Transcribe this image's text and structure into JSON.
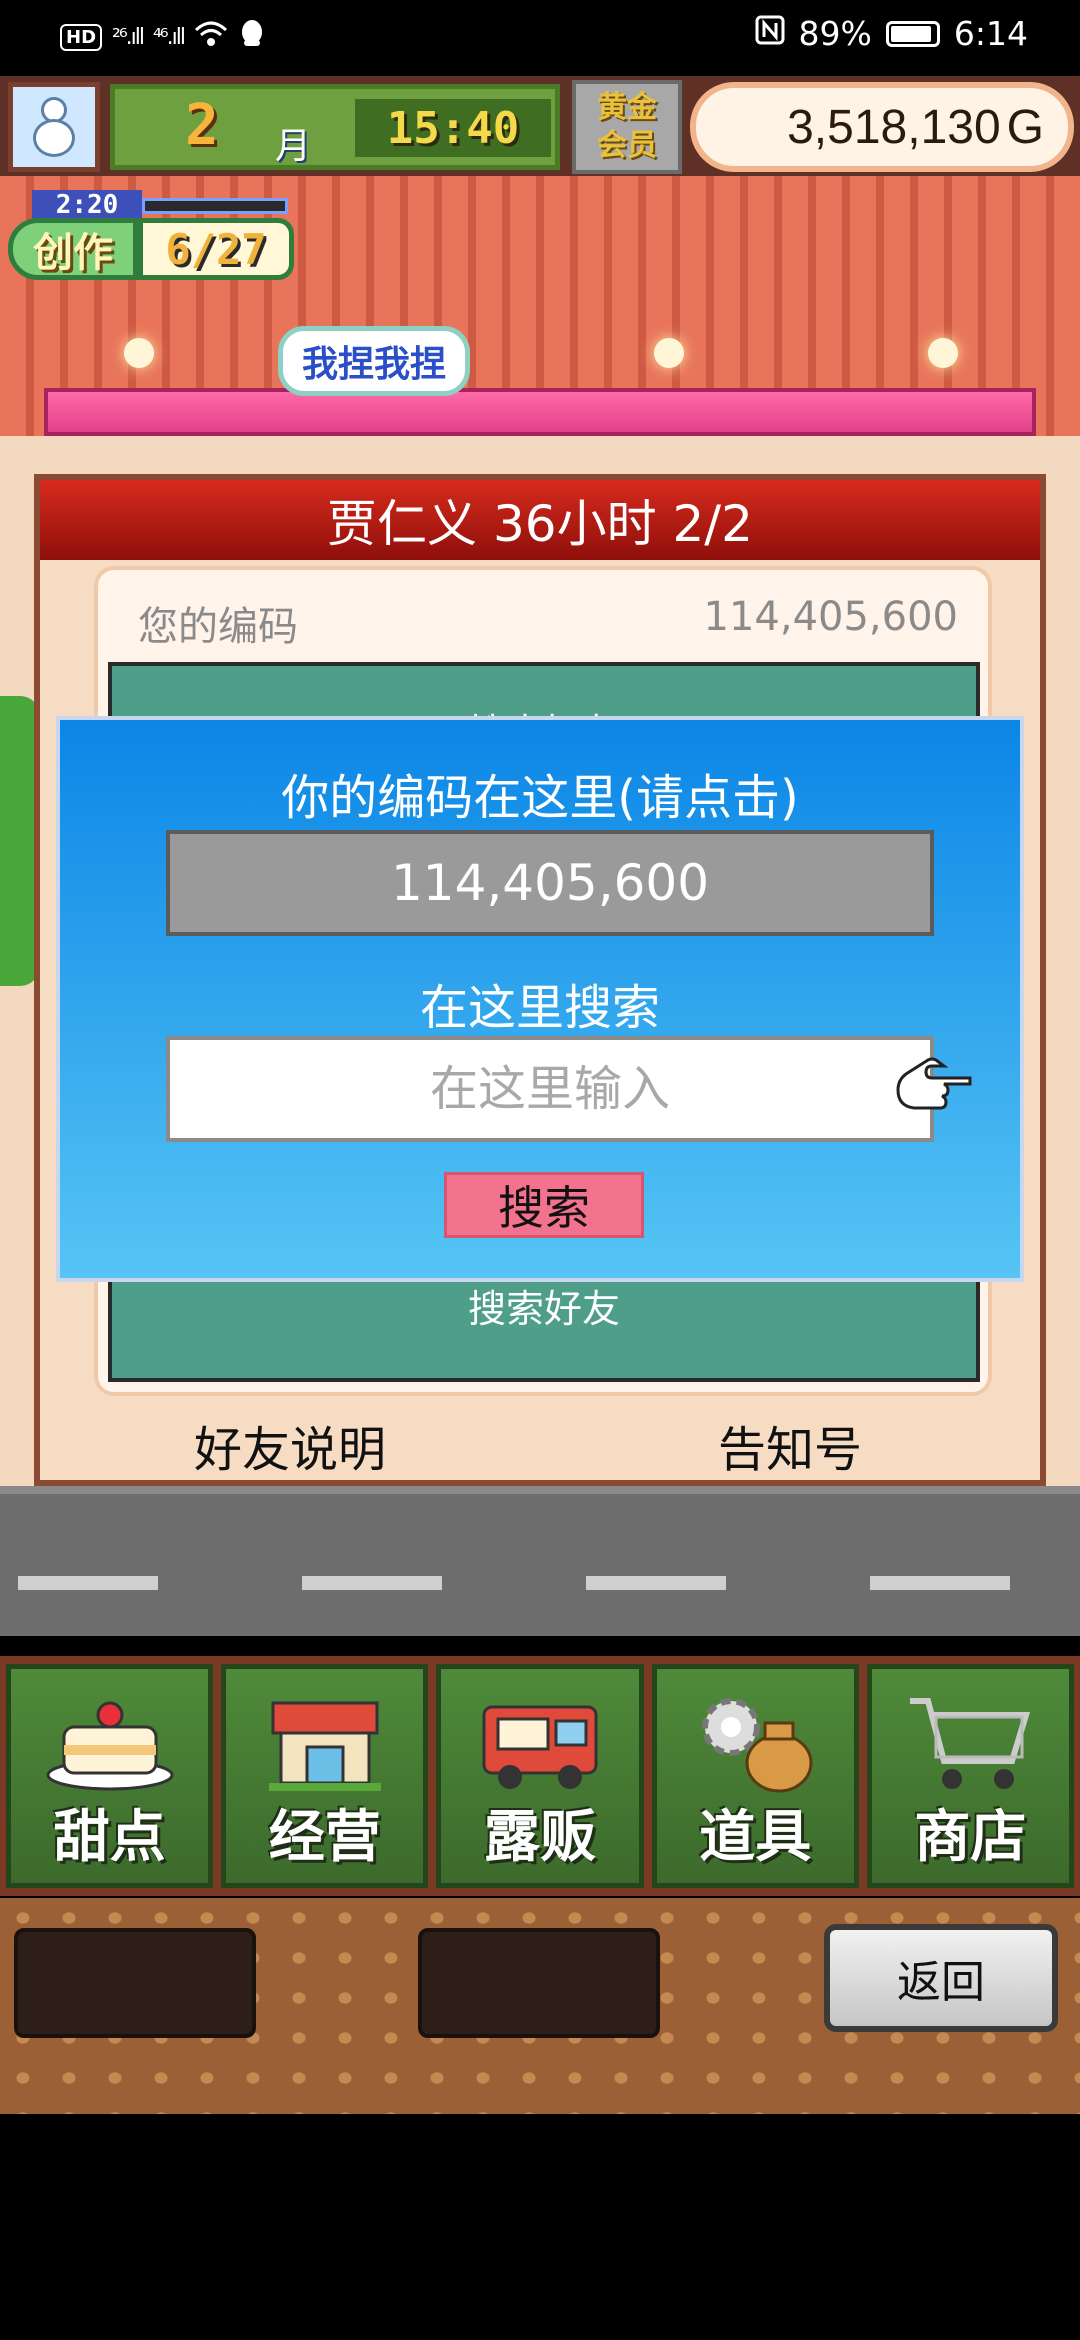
{
  "status_bar": {
    "hd_label": "HD",
    "signal_1": "²⁶.ıll",
    "signal_2": "⁴⁶.ıll",
    "battery_percent": "89%",
    "time": "6:14"
  },
  "hud": {
    "month_number": "2",
    "month_unit": "月",
    "game_time": "15:40",
    "gold_member_label": "黄金\n会员",
    "money_value": "3,518,130",
    "money_unit": "G",
    "create_timer": "2:20",
    "create_label": "创作",
    "create_count": "6/27",
    "speech_bubble": "我捏我捏"
  },
  "panel": {
    "title": "贾仁义  36小时 2/2",
    "your_code_label": "您的编码",
    "your_code_value": "114,405,600",
    "teal_top_text": "搜索好友",
    "teal_bottom_text": "搜索好友",
    "footer_left": "好友说明",
    "footer_right": "告知号"
  },
  "dialog": {
    "title": "你的编码在这里(请点击)",
    "code_value": "114,405,600",
    "search_heading": "在这里搜索",
    "input_placeholder": "在这里输入",
    "input_value": "",
    "search_button": "搜索"
  },
  "menu": {
    "items": [
      {
        "label": "甜点",
        "icon": "cake-icon"
      },
      {
        "label": "经营",
        "icon": "shop-icon"
      },
      {
        "label": "露贩",
        "icon": "food-truck-icon"
      },
      {
        "label": "道具",
        "icon": "items-bag-icon"
      },
      {
        "label": "商店",
        "icon": "shopping-cart-icon"
      }
    ]
  },
  "bottom": {
    "back_button": "返回"
  }
}
